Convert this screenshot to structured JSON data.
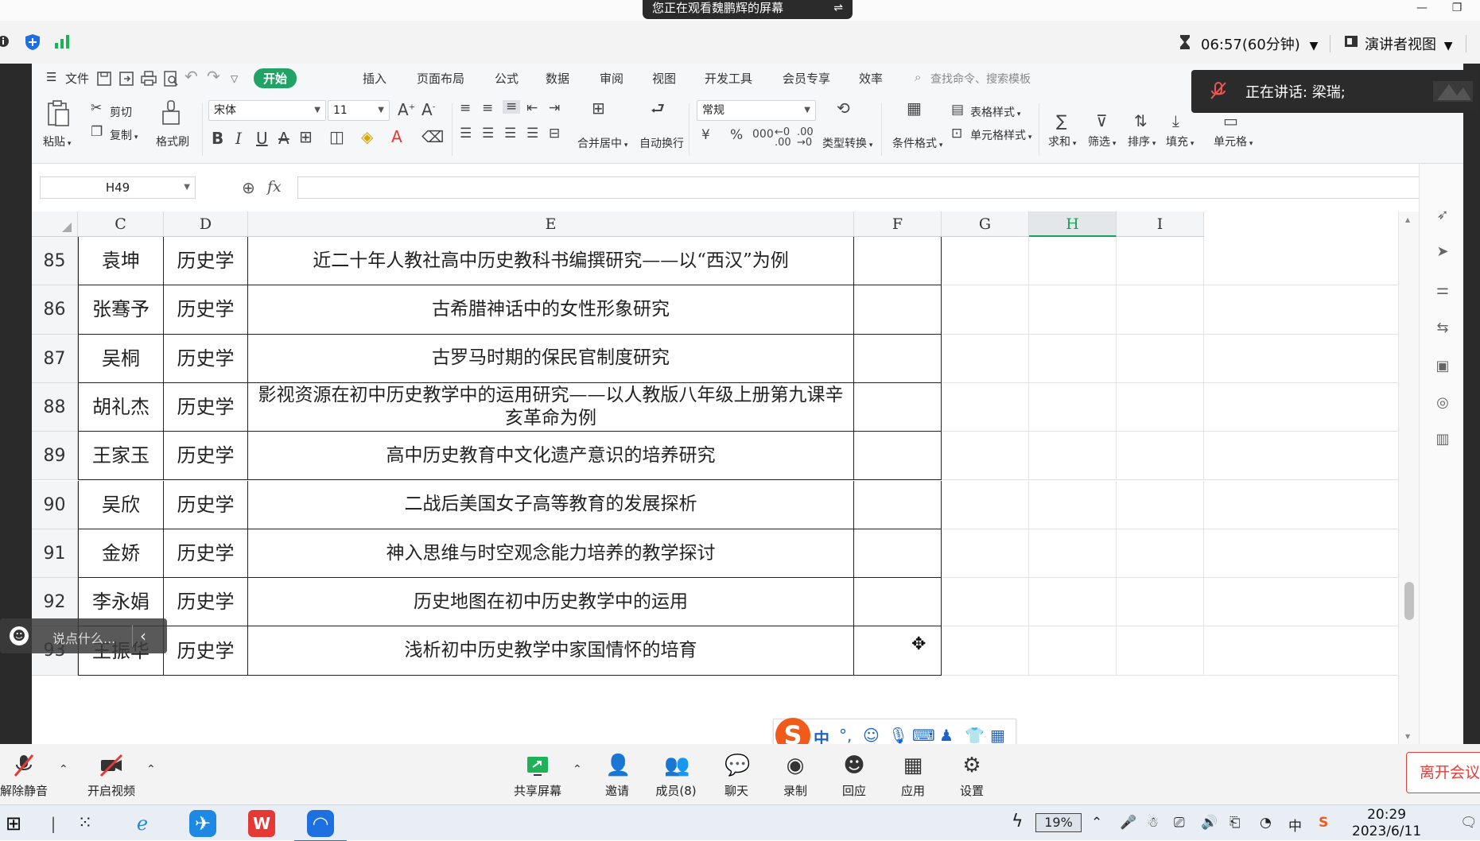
{
  "share": {
    "banner_text": "您正在观看魏鹏辉的屏幕",
    "banner_icon": "⇌",
    "minimize": "—",
    "restore": "❐"
  },
  "meeting_top": {
    "timer": "06:57(60分钟)",
    "presenter_view": "演讲者视图",
    "speaking_label": "正在讲话:  梁瑞;"
  },
  "menu": {
    "file": "文件",
    "tabs": [
      "开始",
      "插入",
      "页面布局",
      "公式",
      "数据",
      "审阅",
      "视图",
      "开发工具",
      "会员专享",
      "效率"
    ],
    "active_tab": "开始",
    "search_placeholder": "查找命令、搜索模板"
  },
  "ribbon": {
    "paste": "粘贴",
    "cut": "剪切",
    "copy": "复制",
    "format_painter": "格式刷",
    "font_name": "宋体",
    "font_size": "11",
    "merge_center": "合并居中",
    "wrap_text": "自动换行",
    "number_format": "常规",
    "type_convert": "类型转换",
    "conditional_format": "条件格式",
    "table_style": "表格样式",
    "cell_style": "单元格样式",
    "sum": "求和",
    "filter": "筛选",
    "sort": "排序",
    "fill": "填充",
    "cell": "单元格"
  },
  "formula_bar": {
    "name_box": "H49",
    "fx": "fx",
    "value": ""
  },
  "columns": [
    "C",
    "D",
    "E",
    "F",
    "G",
    "H",
    "I"
  ],
  "selected_column": "H",
  "rows": [
    {
      "num": "85",
      "name": "袁坤",
      "major": "历史学",
      "title": "近二十年人教社高中历史教科书编撰研究——以“西汉”为例"
    },
    {
      "num": "86",
      "name": "张骞予",
      "major": "历史学",
      "title": "古希腊神话中的女性形象研究"
    },
    {
      "num": "87",
      "name": "吴桐",
      "major": "历史学",
      "title": "古罗马时期的保民官制度研究"
    },
    {
      "num": "88",
      "name": "胡礼杰",
      "major": "历史学",
      "title": "影视资源在初中历史教学中的运用研究——以人教版八年级上册第九课辛亥革命为例"
    },
    {
      "num": "89",
      "name": "王家玉",
      "major": "历史学",
      "title": "高中历史教育中文化遗产意识的培养研究"
    },
    {
      "num": "90",
      "name": "吴欣",
      "major": "历史学",
      "title": "二战后美国女子高等教育的发展探析"
    },
    {
      "num": "91",
      "name": "金娇",
      "major": "历史学",
      "title": "神入思维与时空观念能力培养的教学探讨"
    },
    {
      "num": "92",
      "name": "李永娟",
      "major": "历史学",
      "title": "历史地图在初中历史教学中的运用"
    },
    {
      "num": "93",
      "name": "王振华",
      "major": "历史学",
      "title": "浅析初中历史教学中家国情怀的培育"
    }
  ],
  "chat": {
    "placeholder": "说点什么..."
  },
  "ime": {
    "mode": "中",
    "punct": "°,"
  },
  "controls": {
    "unmute": "解除静音",
    "start_video": "开启视频",
    "share_screen": "共享屏幕",
    "invite": "邀请",
    "members": "成员(8)",
    "chat": "聊天",
    "record": "录制",
    "reaction": "回应",
    "apps": "应用",
    "settings": "设置",
    "leave": "离开会议"
  },
  "taskbar": {
    "battery": "19%",
    "ime_indicator": "中",
    "time": "20:29",
    "date": "2023/6/11"
  },
  "colors": {
    "wps_green": "#21a366",
    "leave_red": "#e0403a",
    "sogou_orange": "#f25a1a"
  }
}
